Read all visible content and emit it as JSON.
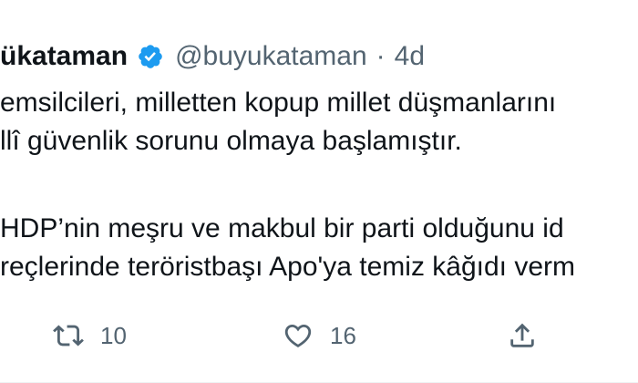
{
  "tweet": {
    "name": "ükataman",
    "handle": "@buyukataman",
    "separator": "·",
    "time": "4d",
    "verified": true,
    "lines": [
      "emsilcileri, milletten kopup millet düşmanlarını",
      "llî güvenlik sorunu olmaya başlamıştır.",
      " HDP’nin meşru ve makbul bir parti olduğunu id",
      "reçlerinde teröristbaşı Apo'ya temiz kâğıdı verm"
    ]
  },
  "actions": {
    "retweet_count": "10",
    "like_count": "16"
  },
  "icons": {
    "verified": "verified-badge-icon",
    "retweet": "retweet-icon",
    "like": "heart-icon",
    "share": "share-icon"
  },
  "colors": {
    "text": "#0f1419",
    "secondary": "#536471",
    "verified": "#1d9bf0"
  }
}
